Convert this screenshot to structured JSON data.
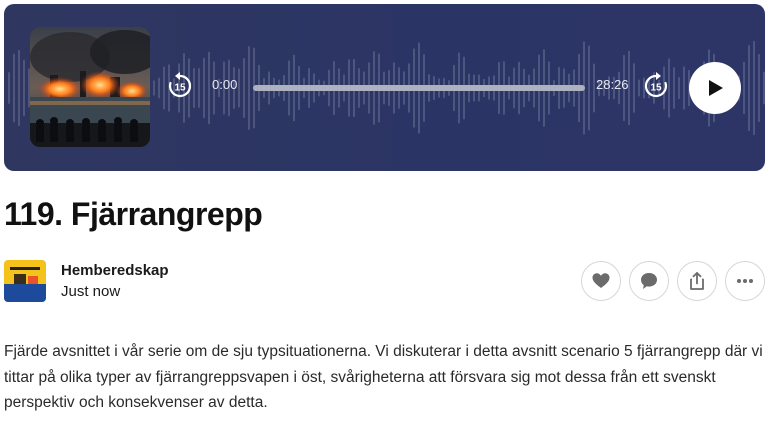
{
  "player": {
    "current_time": "0:00",
    "duration": "28:26",
    "progress": 0,
    "skip_back_seconds": "15",
    "skip_forward_seconds": "15",
    "background_color": "#2d3562"
  },
  "episode": {
    "title": "119. Fjärrangrepp",
    "publisher": "Hemberedskap",
    "date": "Just now",
    "description": "Fjärde avsnittet i vår serie om de sju typsituationerna. Vi diskuterar i detta avsnitt scenario 5 fjärrangrepp där vi tittar på olika typer av fjärrangreppsvapen i öst, svårigheterna att försvara sig mot dessa från ett svenskt perspektiv och konsekvenser av detta."
  },
  "actions": {
    "icons": [
      "heart-icon",
      "comment-icon",
      "share-icon",
      "more-icon"
    ]
  }
}
